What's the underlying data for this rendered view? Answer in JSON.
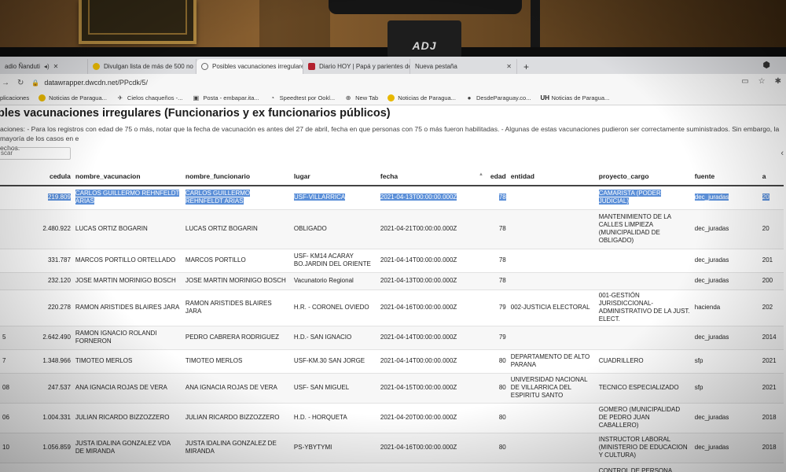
{
  "webcam": {
    "brand": "ADJ"
  },
  "browser": {
    "tabs": [
      {
        "label": "adio Ñanduti",
        "favicon": "speaker",
        "active": false
      },
      {
        "label": "Divulgan lista de más de 500 no",
        "favicon": "yellow",
        "active": false
      },
      {
        "label": "Posibles vacunaciones irregulares",
        "favicon": "globe",
        "active": true
      },
      {
        "label": "Diario HOY | Papá y parientes de",
        "favicon": "red",
        "active": false
      },
      {
        "label": "Nueva pestaña",
        "favicon": "none",
        "active": false
      }
    ],
    "url": "datawrapper.dwcdn.net/PPcdk/5/",
    "bookmarks": [
      {
        "label": "plicaciones",
        "icon": "apps-icon"
      },
      {
        "label": "Noticias de Paragua...",
        "icon": "yellow-dot"
      },
      {
        "label": "Cielos chaqueños -...",
        "icon": "plane-icon"
      },
      {
        "label": "Posta - embapar.ita...",
        "icon": "posta-icon"
      },
      {
        "label": "Speedtest por Ookl...",
        "icon": "gauge-icon"
      },
      {
        "label": "New Tab",
        "icon": "globe-icon"
      },
      {
        "label": "Noticias de Paragua...",
        "icon": "yellow-dot"
      },
      {
        "label": "DesdeParaguay.co...",
        "icon": "apple-icon"
      },
      {
        "label": "Noticias de Paragua...",
        "icon": "uh-icon"
      }
    ]
  },
  "page": {
    "title": "bles vacunaciones irregulares (Funcionarios y ex funcionarios públicos)",
    "description": "aciones: - Para los registros con edad de 75 o más, notar que la fecha de vacunación es antes del 27 de abril, fecha en que personas con 75 o más fueron habilitadas. - Algunas de estas vacunaciones pudieron ser correctamente suministrados. Sin embargo, la mayoría de los casos en e",
    "description_line2": "echos.",
    "search_placeholder": "scar"
  },
  "table": {
    "columns": [
      "",
      "cedula",
      "nombre_vacunacion",
      "nombre_funcionario",
      "lugar",
      "fecha",
      "edad",
      "entidad",
      "proyecto_cargo",
      "fuente",
      "a"
    ],
    "rows": [
      {
        "idx": "",
        "cedula": "219.809",
        "nombre_vacunacion": "CARLOS GUILLERMO REHNFELDT ARIAS",
        "nombre_funcionario": "CARLOS GUILLERMO REHNFELDT ARIAS",
        "lugar": "USF-VILLARRICA",
        "fecha": "2021-04-13T00:00:00.000Z",
        "edad": "78",
        "entidad": "",
        "proyecto_cargo": "CAMARISTA (PODER JUDICIAL)",
        "fuente": "dec_juradas",
        "anio": "20",
        "selected": true
      },
      {
        "idx": "",
        "cedula": "2.480.922",
        "nombre_vacunacion": "LUCAS ORTIZ BOGARIN",
        "nombre_funcionario": "LUCAS ORTIZ BOGARIN",
        "lugar": "OBLIGADO",
        "fecha": "2021-04-21T00:00:00.000Z",
        "edad": "78",
        "entidad": "",
        "proyecto_cargo": "MANTENIMIENTO DE LA CALLES LIMPIEZA (MUNICIPALIDAD DE OBLIGADO)",
        "fuente": "dec_juradas",
        "anio": "20",
        "selected": false
      },
      {
        "idx": "",
        "cedula": "331.787",
        "nombre_vacunacion": "MARCOS PORTILLO ORTELLADO",
        "nombre_funcionario": "MARCOS PORTILLO",
        "lugar": "USF- KM14 ACARAY BO.JARDIN DEL ORIENTE",
        "fecha": "2021-04-14T00:00:00.000Z",
        "edad": "78",
        "entidad": "",
        "proyecto_cargo": "",
        "fuente": "dec_juradas",
        "anio": "201",
        "selected": false
      },
      {
        "idx": "",
        "cedula": "232.120",
        "nombre_vacunacion": "JOSE MARTIN MORINIGO BOSCH",
        "nombre_funcionario": "JOSE MARTIN MORINIGO BOSCH",
        "lugar": "Vacunatorio Regional",
        "fecha": "2021-04-13T00:00:00.000Z",
        "edad": "78",
        "entidad": "",
        "proyecto_cargo": "",
        "fuente": "dec_juradas",
        "anio": "200",
        "selected": false
      },
      {
        "idx": "",
        "cedula": "220.278",
        "nombre_vacunacion": "RAMON ARISTIDES BLAIRES JARA",
        "nombre_funcionario": "RAMON ARISTIDES BLAIRES JARA",
        "lugar": "H.R. - CORONEL OVIEDO",
        "fecha": "2021-04-16T00:00:00.000Z",
        "edad": "79",
        "entidad": "002-JUSTICIA ELECTORAL",
        "proyecto_cargo": "001-GESTIÓN JURISDICCIONAL-ADMINISTRATIVO DE LA JUST. ELECT.",
        "fuente": "hacienda",
        "anio": "202",
        "selected": false
      },
      {
        "idx": "5",
        "cedula": "2.642.490",
        "nombre_vacunacion": "RAMON IGNACIO ROLANDI FORNERON",
        "nombre_funcionario": "PEDRO CABRERA RODRIGUEZ",
        "lugar": "H.D.- SAN IGNACIO",
        "fecha": "2021-04-14T00:00:00.000Z",
        "edad": "79",
        "entidad": "",
        "proyecto_cargo": "",
        "fuente": "dec_juradas",
        "anio": "2014",
        "selected": false
      },
      {
        "idx": "7",
        "cedula": "1.348.966",
        "nombre_vacunacion": "TIMOTEO MERLOS",
        "nombre_funcionario": "TIMOTEO MERLOS",
        "lugar": "USF-KM.30 SAN JORGE",
        "fecha": "2021-04-14T00:00:00.000Z",
        "edad": "80",
        "entidad": "DEPARTAMENTO DE ALTO PARANA",
        "proyecto_cargo": "CUADRILLERO",
        "fuente": "sfp",
        "anio": "2021",
        "selected": false
      },
      {
        "idx": "08",
        "cedula": "247.537",
        "nombre_vacunacion": "ANA IGNACIA ROJAS DE VERA",
        "nombre_funcionario": "ANA IGNACIA ROJAS DE VERA",
        "lugar": "USF- SAN MIGUEL",
        "fecha": "2021-04-15T00:00:00.000Z",
        "edad": "80",
        "entidad": "UNIVERSIDAD NACIONAL DE VILLARRICA DEL ESPIRITU SANTO",
        "proyecto_cargo": "TECNICO ESPECIALIZADO",
        "fuente": "sfp",
        "anio": "2021",
        "selected": false
      },
      {
        "idx": "06",
        "cedula": "1.004.331",
        "nombre_vacunacion": "JULIAN RICARDO BIZZOZZERO",
        "nombre_funcionario": "JULIAN RICARDO BIZZOZZERO",
        "lugar": "H.D. - HORQUETA",
        "fecha": "2021-04-20T00:00:00.000Z",
        "edad": "80",
        "entidad": "",
        "proyecto_cargo": "GOMERO (MUNICIPALIDAD DE PEDRO JUAN CABALLERO)",
        "fuente": "dec_juradas",
        "anio": "2018",
        "selected": false
      },
      {
        "idx": "10",
        "cedula": "1.056.859",
        "nombre_vacunacion": "JUSTA IDALINA GONZALEZ VDA DE MIRANDA",
        "nombre_funcionario": "JUSTA IDALINA GONZALEZ DE MIRANDA",
        "lugar": "PS-YBYTYMI",
        "fecha": "2021-04-16T00:00:00.000Z",
        "edad": "80",
        "entidad": "",
        "proyecto_cargo": "INSTRUCTOR LABORAL (MINISTERIO DE EDUCACION Y CULTURA)",
        "fuente": "dec_juradas",
        "anio": "2018",
        "selected": false
      },
      {
        "idx": "",
        "cedula": "",
        "nombre_vacunacion": "",
        "nombre_funcionario": "",
        "lugar": "",
        "fecha": "",
        "edad": "",
        "entidad": "",
        "proyecto_cargo": "CONTROL DE PERSONA",
        "fuente": "",
        "anio": "",
        "selected": false
      }
    ]
  }
}
